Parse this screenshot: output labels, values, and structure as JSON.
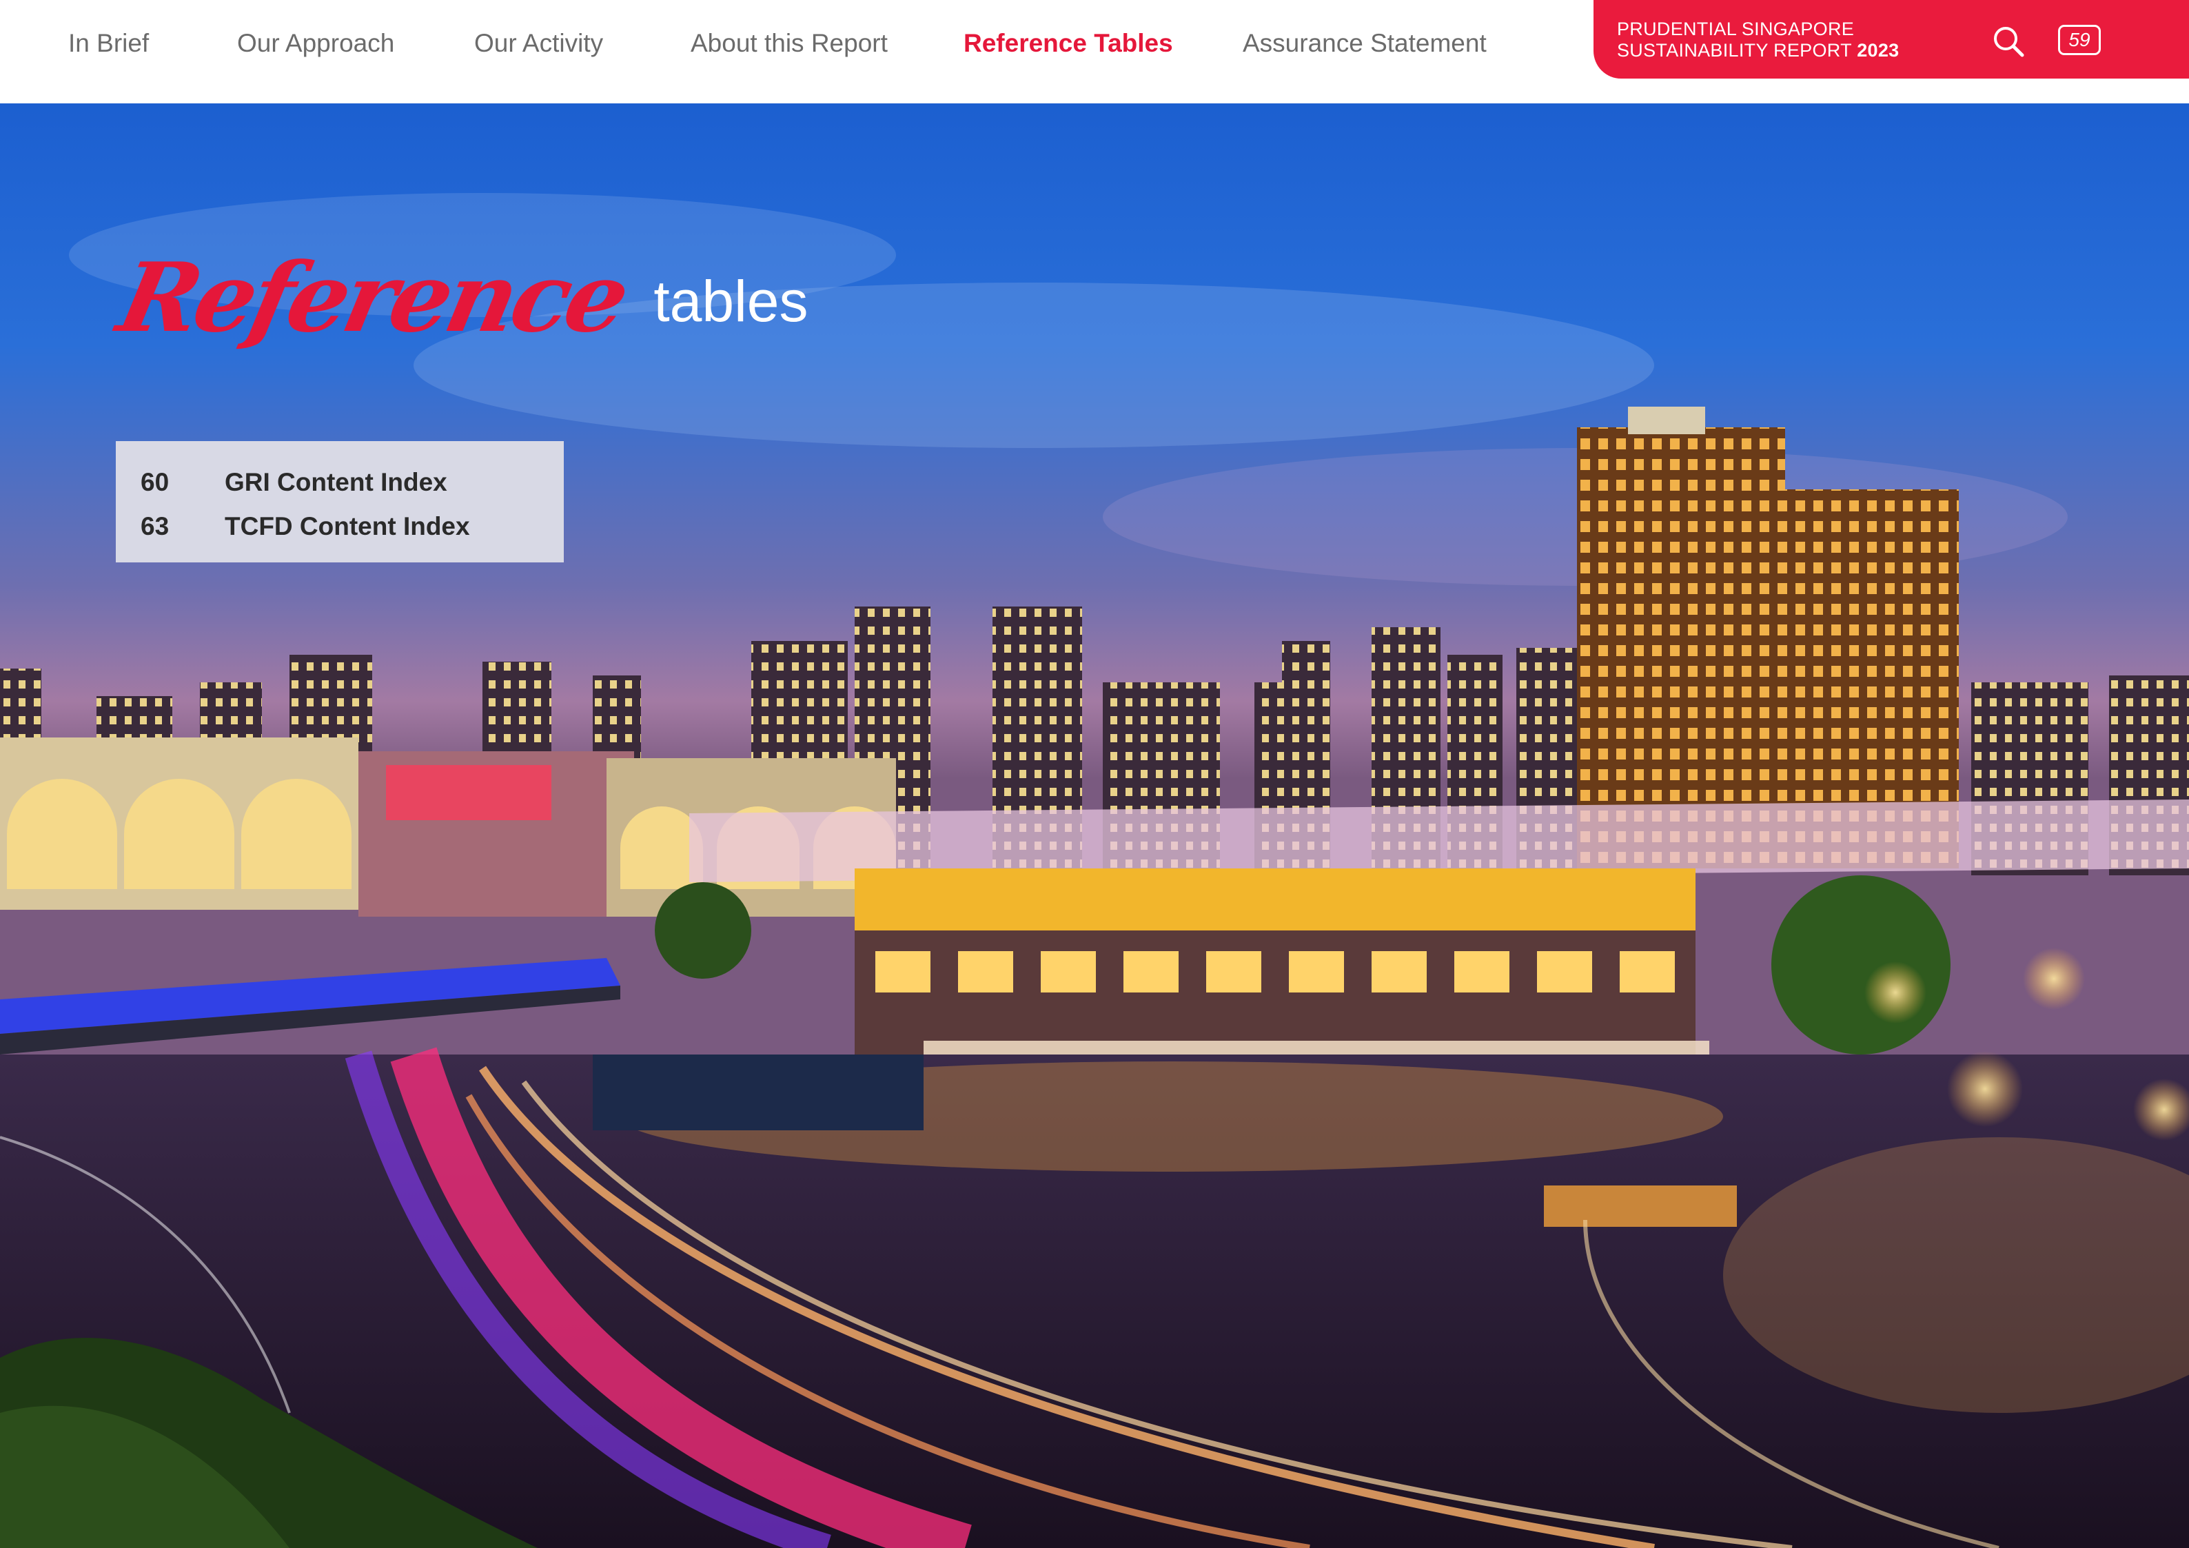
{
  "nav": {
    "items": [
      {
        "label": "In Brief"
      },
      {
        "label": "Our Approach"
      },
      {
        "label": "Our Activity"
      },
      {
        "label": "About this Report"
      },
      {
        "label": "Reference Tables"
      },
      {
        "label": "Assurance Statement"
      }
    ],
    "active_index": 4
  },
  "badge": {
    "line1": "PRUDENTIAL SINGAPORE",
    "line2": "SUSTAINABILITY REPORT",
    "year": "2023",
    "page_number": "59",
    "search_icon": "search-icon"
  },
  "title": {
    "script": "Reference",
    "plain": "tables"
  },
  "index": [
    {
      "page": "60",
      "label": "GRI Content Index"
    },
    {
      "page": "63",
      "label": "TCFD Content Index"
    }
  ],
  "colors": {
    "accent": "#E5173A",
    "badge": "#EA1B3D",
    "nav_text": "#6B6B6B",
    "index_box": "#D8D9E5"
  }
}
